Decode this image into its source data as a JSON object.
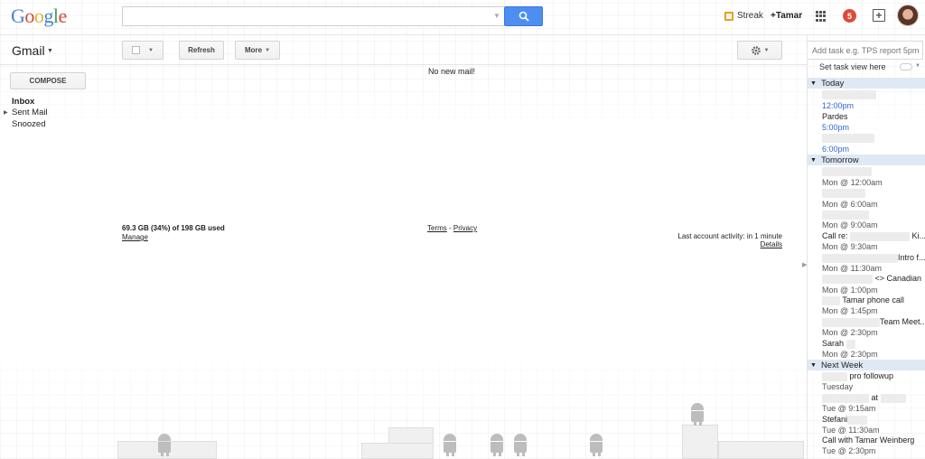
{
  "header": {
    "logo": [
      "G",
      "o",
      "o",
      "g",
      "l",
      "e"
    ],
    "search_value": "",
    "streak_label": "Streak",
    "plus_user": "+Tamar",
    "notification_count": "5"
  },
  "toolbar": {
    "app_label": "Gmail",
    "refresh_label": "Refresh",
    "more_label": "More",
    "task_input_placeholder": "Add task e.g. TPS report 5pm"
  },
  "nav": {
    "compose_label": "COMPOSE",
    "inbox": "Inbox",
    "sent": "Sent Mail",
    "snoozed": "Snoozed"
  },
  "main": {
    "empty_message": "No new mail!",
    "storage": "69.3 GB (34%) of 198 GB used",
    "manage": "Manage",
    "terms": "Terms",
    "terms_sep": " - ",
    "privacy": "Privacy",
    "activity": "Last account activity: in 1 minute",
    "details": "Details"
  },
  "tasks": {
    "view_label": "Set task view here",
    "sections": {
      "today": "Today",
      "tomorrow": "Tomorrow",
      "next_week": "Next Week"
    },
    "items": {
      "t1": "12:00pm",
      "t2": "Pardes",
      "t3": "5:00pm",
      "t4": "6:00pm",
      "m1": "Mon @ 12:00am",
      "m2": "Mon @ 6:00am",
      "m3": "Mon @ 9:00am",
      "call_re": "Call re:",
      "ki": "Ki...",
      "m4": "Mon @ 9:30am",
      "intro": "Intro f...",
      "m5": "Mon @ 11:30am",
      "canadian": "<> Canadian",
      "m6": "Mon @ 1:00pm",
      "tamar_call": "Tamar phone call",
      "m7": "Mon @ 1:45pm",
      "team_meet": "Team Meet...",
      "m8": "Mon @ 2:30pm",
      "sarah": "Sarah",
      "m9": "Mon @ 2:30pm",
      "pro_followup": "pro followup",
      "tuesday": "Tuesday",
      "at": "at",
      "tu1": "Tue @ 9:15am",
      "stefani": "Stefani",
      "tu2": "Tue @ 11:30am",
      "call_tamar": "Call with Tamar Weinberg",
      "tu3": "Tue @ 2:30pm"
    }
  }
}
